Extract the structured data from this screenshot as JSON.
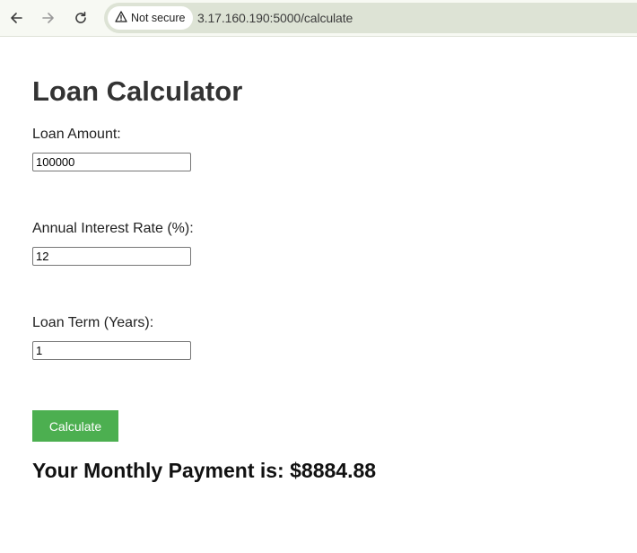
{
  "browser": {
    "security_label": "Not secure",
    "url": "3.17.160.190:5000/calculate",
    "icons": {
      "back": "back-arrow-icon",
      "forward": "forward-arrow-icon",
      "reload": "reload-icon",
      "warning": "warning-triangle-icon"
    }
  },
  "page": {
    "title": "Loan Calculator",
    "fields": [
      {
        "label": "Loan Amount:",
        "value": "100000"
      },
      {
        "label": "Annual Interest Rate (%):",
        "value": "12"
      },
      {
        "label": "Loan Term (Years):",
        "value": "1"
      }
    ],
    "button_label": "Calculate",
    "result": "Your Monthly Payment is: $8884.88"
  },
  "colors": {
    "button_background": "#4caf50",
    "toolbar_background": "#f7f9f3",
    "omnibox_background": "#dde3d5"
  }
}
